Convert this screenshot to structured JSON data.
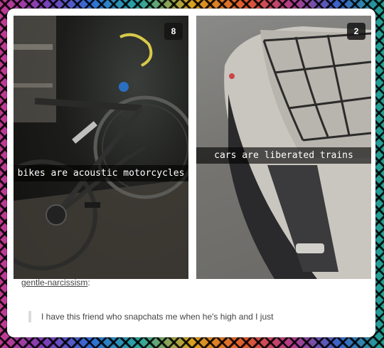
{
  "post": {
    "images": [
      {
        "counter": "8",
        "caption": "bikes are acoustic motorcycles"
      },
      {
        "counter": "2",
        "caption": "cars are liberated trains"
      }
    ],
    "author": "gentle-narcissism",
    "author_suffix": ":",
    "quote": "I have this friend who snapchats me when he's high and I just"
  }
}
